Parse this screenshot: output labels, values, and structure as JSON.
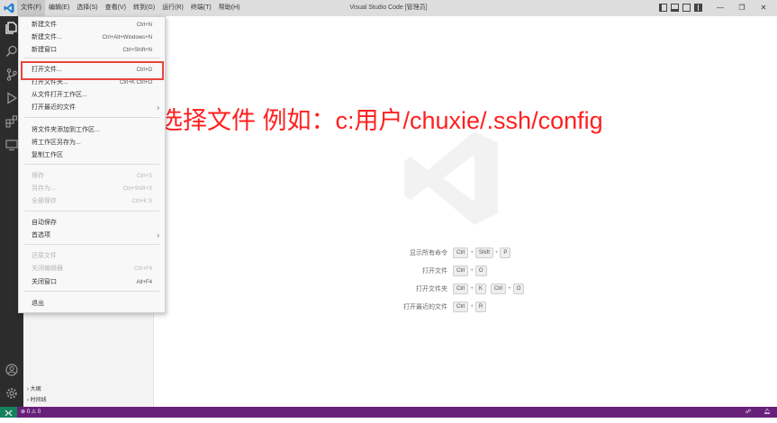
{
  "titlebar": {
    "title": "Visual Studio Code [管理员]",
    "menu": [
      "文件(F)",
      "编辑(E)",
      "选择(S)",
      "查看(V)",
      "转到(G)",
      "运行(R)",
      "终端(T)",
      "帮助(H)"
    ],
    "window_controls": {
      "minimize": "—",
      "restore": "❐",
      "close": "✕"
    }
  },
  "file_menu": {
    "items": [
      {
        "label": "新建文件",
        "shortcut": "Ctrl+N",
        "disabled": false
      },
      {
        "label": "新建文件...",
        "shortcut": "Ctrl+Alt+Windows+N",
        "disabled": false
      },
      {
        "label": "新建窗口",
        "shortcut": "Ctrl+Shift+N",
        "disabled": false
      },
      {
        "label": "打开文件...",
        "shortcut": "Ctrl+O",
        "disabled": false
      },
      {
        "label": "打开文件夹...",
        "shortcut": "Ctrl+K Ctrl+O",
        "disabled": false
      },
      {
        "label": "从文件打开工作区...",
        "shortcut": "",
        "disabled": false
      },
      {
        "label": "打开最近的文件",
        "shortcut": "",
        "disabled": false,
        "submenu": true
      },
      {
        "label": "将文件夹添加到工作区...",
        "shortcut": "",
        "disabled": false
      },
      {
        "label": "将工作区另存为...",
        "shortcut": "",
        "disabled": false
      },
      {
        "label": "复制工作区",
        "shortcut": "",
        "disabled": false
      },
      {
        "label": "保存",
        "shortcut": "Ctrl+S",
        "disabled": true
      },
      {
        "label": "另存为...",
        "shortcut": "Ctrl+Shift+S",
        "disabled": true
      },
      {
        "label": "全部保存",
        "shortcut": "Ctrl+K S",
        "disabled": true
      },
      {
        "label": "自动保存",
        "shortcut": "",
        "disabled": false
      },
      {
        "label": "首选项",
        "shortcut": "",
        "disabled": false,
        "submenu": true
      },
      {
        "label": "还原文件",
        "shortcut": "",
        "disabled": true
      },
      {
        "label": "关闭编辑器",
        "shortcut": "Ctrl+F4",
        "disabled": true
      },
      {
        "label": "关闭窗口",
        "shortcut": "Alt+F4",
        "disabled": false
      },
      {
        "label": "退出",
        "shortcut": "",
        "disabled": false
      }
    ],
    "submenu_arrow": "›"
  },
  "sidebar": {
    "sections": [
      {
        "chevron": "›",
        "label": "大纲"
      },
      {
        "chevron": "›",
        "label": "时间线"
      }
    ]
  },
  "annotation": {
    "text": "选择文件 例如：c:用户/chuxie/.ssh/config",
    "color": "#ff1f1f"
  },
  "welcome_shortcuts": [
    {
      "label": "显示所有命令",
      "keys": [
        [
          "Ctrl",
          "Shift",
          "P"
        ]
      ]
    },
    {
      "label": "打开文件",
      "keys": [
        [
          "Ctrl",
          "O"
        ]
      ]
    },
    {
      "label": "打开文件夹",
      "keys": [
        [
          "Ctrl",
          "K"
        ],
        [
          "Ctrl",
          "O"
        ]
      ]
    },
    {
      "label": "打开最近的文件",
      "keys": [
        [
          "Ctrl",
          "R"
        ]
      ]
    }
  ],
  "statusbar": {
    "errors": "0",
    "warnings": "0",
    "color": "#68217a",
    "remote_color": "#16825d"
  },
  "colors": {
    "activitybar": "#2c2c2c",
    "highlight": "#e8453c"
  }
}
